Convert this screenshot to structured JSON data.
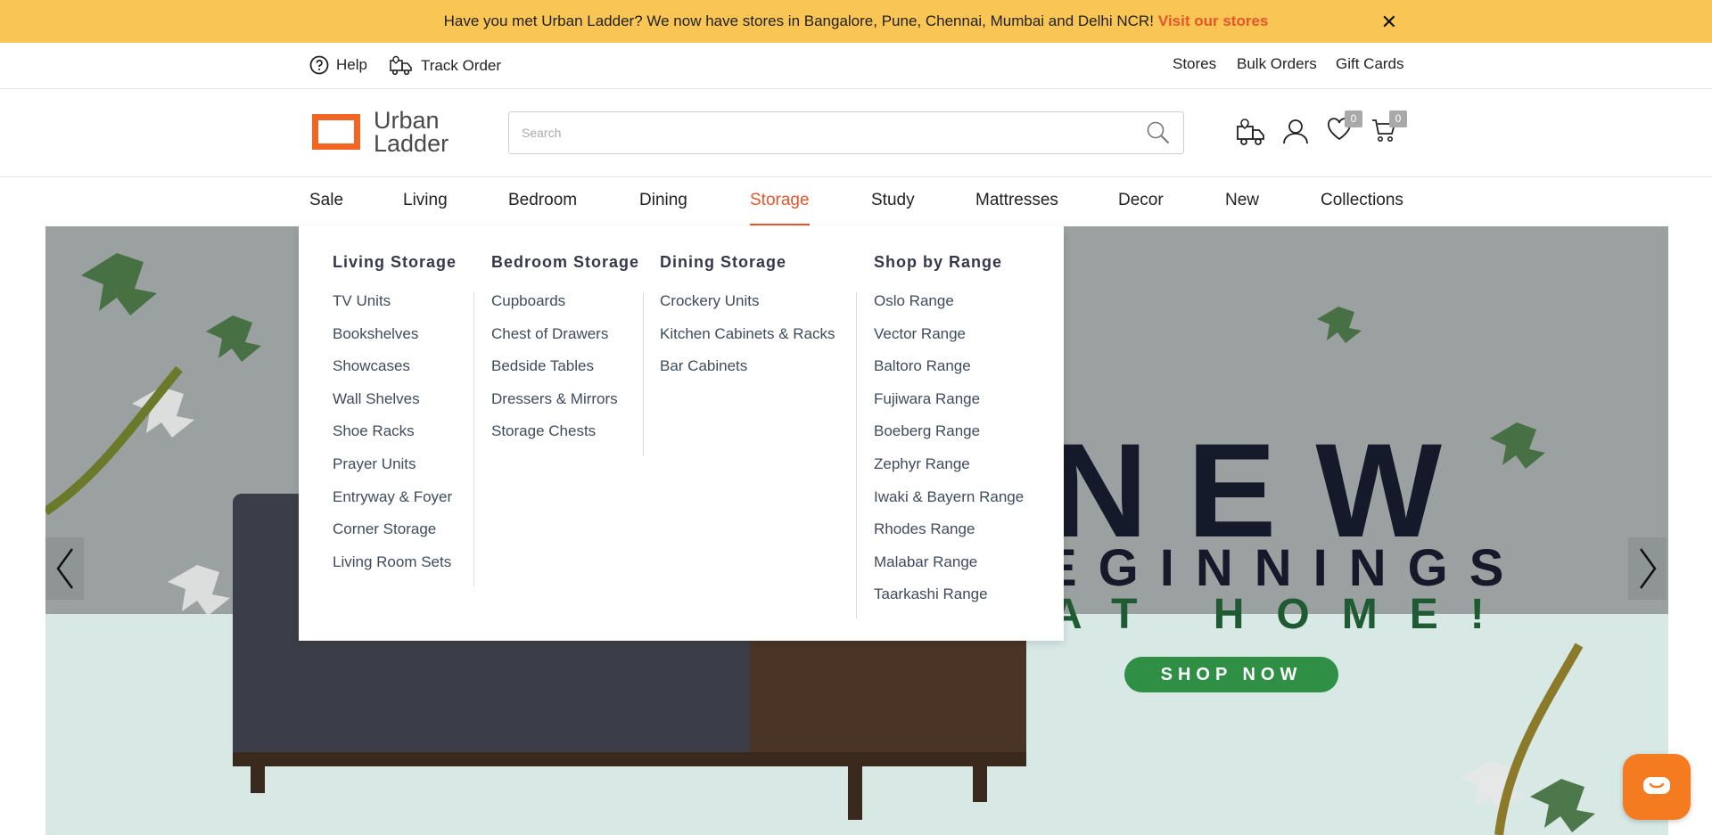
{
  "announcement": {
    "text": "Have you met Urban Ladder? We now have stores in Bangalore, Pune, Chennai, Mumbai and Delhi NCR!",
    "link": "Visit our stores",
    "close": "✕"
  },
  "utility": {
    "help": "Help",
    "track": "Track Order",
    "stores": "Stores",
    "bulk": "Bulk Orders",
    "gift": "Gift Cards"
  },
  "header": {
    "logo_line1": "Urban",
    "logo_line2": "Ladder",
    "search_placeholder": "Search",
    "wishlist_count": "0",
    "cart_count": "0"
  },
  "nav": [
    "Sale",
    "Living",
    "Bedroom",
    "Dining",
    "Storage",
    "Study",
    "Mattresses",
    "Decor",
    "New",
    "Collections"
  ],
  "mega_menu": {
    "columns": [
      {
        "title": "Living Storage",
        "items": [
          "TV Units",
          "Bookshelves",
          "Showcases",
          "Wall Shelves",
          "Shoe Racks",
          "Prayer Units",
          "Entryway & Foyer",
          "Corner Storage",
          "Living Room Sets"
        ]
      },
      {
        "title": "Bedroom Storage",
        "items": [
          "Cupboards",
          "Chest of Drawers",
          "Bedside Tables",
          "Dressers & Mirrors",
          "Storage Chests"
        ]
      },
      {
        "title": "Dining Storage",
        "items": [
          "Crockery Units",
          "Kitchen Cabinets & Racks",
          "Bar Cabinets"
        ]
      },
      {
        "title": "Shop by Range",
        "items": [
          "Oslo Range",
          "Vector Range",
          "Baltoro Range",
          "Fujiwara Range",
          "Boeberg Range",
          "Zephyr Range",
          "Iwaki & Bayern Range",
          "Rhodes Range",
          "Malabar Range",
          "Taarkashi Range"
        ]
      }
    ]
  },
  "hero": {
    "headline": "NEW",
    "line2": "EGINNINGS",
    "line3": "AT HOME!",
    "cta": "SHOP NOW"
  },
  "colors": {
    "accent": "#e3572c",
    "announce_bg": "#f9c554",
    "cta_green": "#2f8f45",
    "chat": "#f47b20"
  }
}
